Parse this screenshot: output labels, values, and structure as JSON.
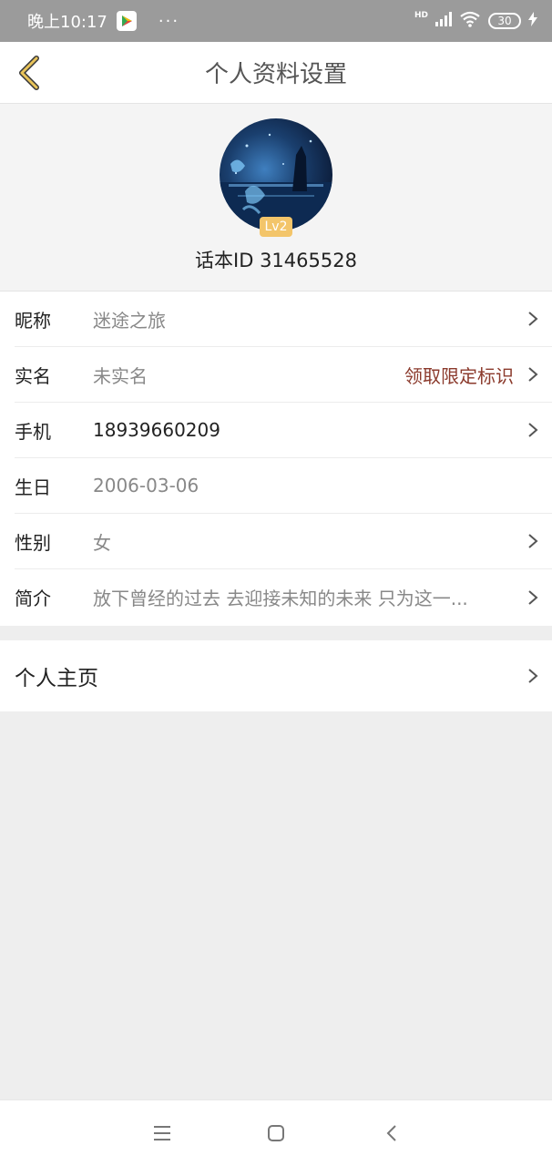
{
  "status_bar": {
    "time": "晚上10:17",
    "dots": "···",
    "network": "HD",
    "battery": "30"
  },
  "nav": {
    "title": "个人资料设置"
  },
  "profile": {
    "level": "Lv2",
    "id_line": "话本ID 31465528"
  },
  "rows": [
    {
      "label": "昵称",
      "value": "迷途之旅"
    },
    {
      "label": "实名",
      "value": "未实名",
      "extra": "领取限定标识"
    },
    {
      "label": "手机",
      "value": "18939660209"
    },
    {
      "label": "生日",
      "value": "2006-03-06"
    },
    {
      "label": "性别",
      "value": "女"
    },
    {
      "label": "简介",
      "value": "放下曾经的过去  去迎接未知的未来  只为这一..."
    }
  ],
  "homepage": {
    "label": "个人主页"
  },
  "colors": {
    "accent": "#f3c56a",
    "link_red": "#8b3a2c",
    "status_bar": "#9b9b9b"
  }
}
